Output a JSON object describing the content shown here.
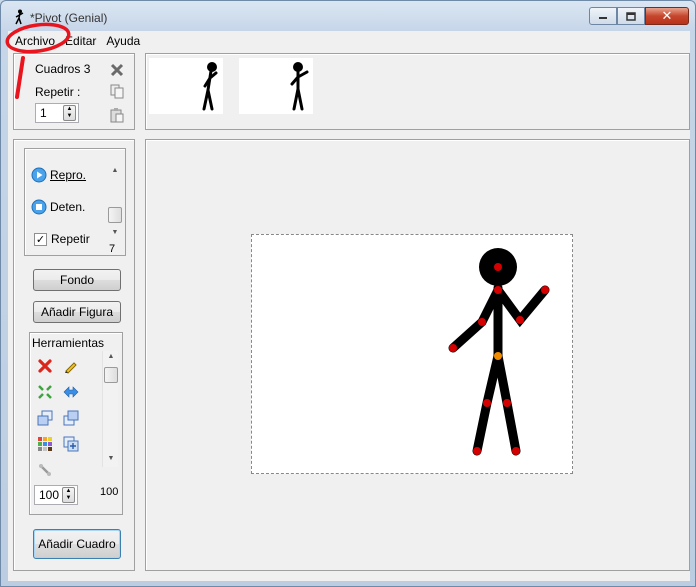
{
  "window": {
    "title": "*Pivot (Genial)"
  },
  "menu": {
    "items": [
      "Archivo",
      "Editar",
      "Ayuda"
    ]
  },
  "frames": {
    "count_label": "Cuadros 3",
    "repeat_label": "Repetir :",
    "repeat_value": "1"
  },
  "playback": {
    "play_label": "Repro.",
    "stop_label": "Deten.",
    "loop_label": "Repetir",
    "loop_checked": true,
    "speed_value": "7"
  },
  "buttons": {
    "background": "Fondo",
    "add_figure": "Añadir Figura",
    "add_frame": "Añadir Cuadro"
  },
  "tools": {
    "group_label": "Herramientas",
    "icons": [
      "delete-icon",
      "edit-icon",
      "center-icon",
      "flip-icon",
      "front-icon",
      "back-icon",
      "color-icon",
      "duplicate-icon",
      "join-icon"
    ],
    "size_value": "100",
    "size_max_label": "100"
  },
  "colors": {
    "annotation": "#e8141e",
    "joint": "#d40000",
    "center_joint": "#f08c00",
    "figure": "#000000",
    "accent": "#3a8ee6"
  }
}
